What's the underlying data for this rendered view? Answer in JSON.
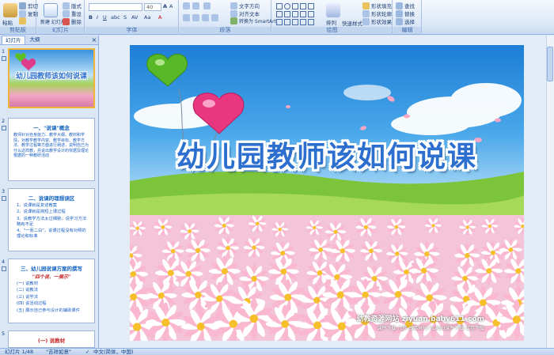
{
  "ribbon": {
    "clipboard": {
      "label": "剪贴板",
      "paste": "粘贴",
      "cut": "剪切",
      "copy": "复制",
      "format": "格式刷"
    },
    "slides": {
      "label": "幻灯片",
      "new_slide": "新建\n幻灯片",
      "layout": "版式",
      "reset": "重设",
      "delete": "删除"
    },
    "font": {
      "label": "字体",
      "size_value": "40"
    },
    "paragraph": {
      "label": "段落",
      "text_direction": "文字方向",
      "align_text": "对齐文本",
      "smartart": "转换为 SmartArt"
    },
    "drawing": {
      "label": "绘图",
      "arrange": "排列",
      "quick_styles": "快速样式",
      "shape_fill": "形状填充",
      "shape_outline": "形状轮廓",
      "shape_effect": "形状效果"
    },
    "editing": {
      "label": "编辑",
      "find": "查找",
      "replace": "替换",
      "select": "选择"
    }
  },
  "left_pane": {
    "tabs": [
      "幻灯片",
      "大纲"
    ],
    "close_icon": "close-icon",
    "thumbs": [
      {
        "num": "1",
        "title": "幼儿园教师该如何说课"
      },
      {
        "num": "2",
        "title": "一、\"说课\"概念",
        "body": "教师针对自身能力、教学大纲、教材和学情，对教学教学内容、教学目标、教学方法、教学过程等方面进行阐述，说明自己为什么这样教，并说出教学设计的依据及理论根据的一种教研活动"
      },
      {
        "num": "3",
        "title": "二、说课的理想误区",
        "items": [
          "1、说课就是复述教案",
          "2、说课就是简短上课过程",
          "3、说教学方法太过细致，说学习方法略有不足",
          "4、\"一而二白\"，说课过程没有对照的理论和标准"
        ]
      },
      {
        "num": "4",
        "title": "三、幼儿园说课方案的撰写",
        "sub": "\"四个说、一展示\"",
        "items": [
          "(一) 说教材",
          "(二) 说教法",
          "(三) 说学法",
          "(四) 说活动过程",
          "(五) 展示自己参与设计的辅助课件"
        ]
      },
      {
        "num": "5",
        "title": "(一) 说教材"
      }
    ]
  },
  "slide": {
    "title": "幼儿园教师该如何说课",
    "footer_main": "幼教资源网站 ziyuan.baby611.com",
    "footer_sub": "课件下载   儿歌   故事MP3   FLASH课件下载   试卷下载"
  },
  "status": {
    "slide_count": "幻灯片 1/48",
    "theme": "\"吉祥如意\"",
    "language": "中文(简体，中国)"
  },
  "colors": {
    "accent": "#15428b",
    "title_blue": "#2c6fcf",
    "grass": "#8cc63f"
  }
}
